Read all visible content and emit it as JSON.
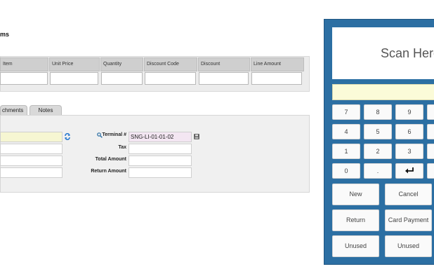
{
  "section": {
    "title": "ms"
  },
  "grid": {
    "columns": [
      "Item",
      "Unit Price",
      "Quantity",
      "Discount Code",
      "Discount",
      "Line Amount"
    ]
  },
  "tabs": {
    "attachments": "chments",
    "notes": "Notes"
  },
  "form": {
    "terminal_label": "Terminal #",
    "terminal_value": "SNG-LI-01-01-02",
    "tax_label": "Tax",
    "total_label": "Total Amount",
    "return_label": "Return Amount"
  },
  "pos": {
    "scan_text": "Scan Here",
    "keys": [
      "7",
      "8",
      "9",
      "4",
      "5",
      "6",
      "1",
      "2",
      "3",
      "0",
      "."
    ],
    "enter_icon": "enter-icon",
    "actions": {
      "new": "New",
      "cancel": "Cancel",
      "return": "Return",
      "card_payment": "Card Payment",
      "unused1": "Unused",
      "unused2": "Unused"
    }
  },
  "colors": {
    "pos_panel": "#2c6fa3",
    "scan_input": "#fbfbd8",
    "terminal_field": "#f3e6f2"
  }
}
